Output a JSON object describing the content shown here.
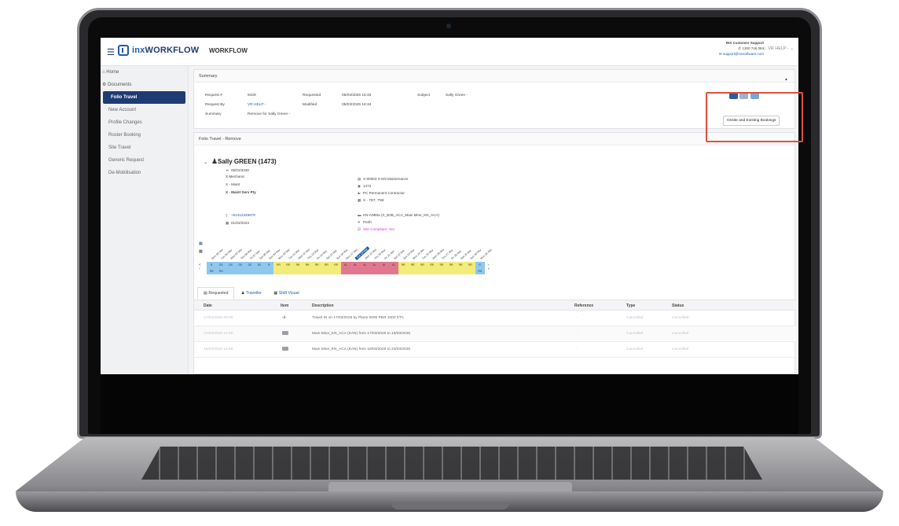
{
  "header": {
    "logo": "WORKFLOW",
    "logo_prefix": "inx",
    "app_title": "WORKFLOW",
    "support_title": "INX Customer Support",
    "support_phone": "1300 746 084",
    "support_email": "support@inxsoftware.com",
    "user": "VR HELP -"
  },
  "sidebar": {
    "items": [
      {
        "label": "Home"
      },
      {
        "label": "Documents"
      },
      {
        "label": "Folio Travel"
      },
      {
        "label": "New Account"
      },
      {
        "label": "Profile Changes"
      },
      {
        "label": "Roster Booking"
      },
      {
        "label": "Site Travel"
      },
      {
        "label": "Generic Request"
      },
      {
        "label": "De-Mobilisation"
      }
    ]
  },
  "summary": {
    "title": "Summary",
    "request_no_label": "Request #",
    "request_no": "9429",
    "request_by_label": "Request By",
    "request_by": "VR HELP -",
    "summary_label": "Summary",
    "summary_value": "Remove for Sally Green -",
    "requested_label": "Requested",
    "requested": "05/03/2025 16:33",
    "modified_label": "Modified",
    "modified": "05/03/2025 16:34",
    "subject_label": "Subject",
    "subject": "Sally Green -",
    "tooltip": "Onsite and Existing Bookings"
  },
  "folio": {
    "title": "Folio Travel - Remove",
    "name": "Sally GREEN (1473)",
    "dob": "05/02/2030",
    "role": "X-Mechanic",
    "dept": "X - Maint",
    "company": "X - Maint Serv Pty",
    "phone": "+61412345678",
    "date": "01/02/2023",
    "cost_centre": "X-00003 X-KN-Maintenance",
    "id": "1473",
    "employment": "PC Permanent Contractor",
    "roster": "X - 7D7, 7N8",
    "accommodation": "KN-A0B0a (X_B2B_ACA_Main Mine_KN_ACA)",
    "city": "Perth",
    "site_compliant": "Site Compliant: Yes"
  },
  "calendar": {
    "days": [
      "Mon 03 Mar",
      "Tue 04 Mar",
      "Wed 05 Mar",
      "Thu 06 Mar",
      "Fri 07 Mar",
      "Sat 08 Mar",
      "Sun 09 Mar",
      "Mon 10 Mar",
      "Tue 11 Mar",
      "Wed 12 Mar",
      "Thu 13 Mar",
      "Fri 14 Mar",
      "Sat 15 Mar",
      "Sun 16 Mar",
      "Mon 17 Mar",
      "Tue 18 Mar",
      "Wed 19 Mar",
      "Thu 20 Mar",
      "Fri 21 Mar",
      "Sat 22 Mar",
      "Sun 23 Mar",
      "Mon 24 Mar",
      "Tue 25 Mar",
      "Wed 26 Mar",
      "Thu 27 Mar",
      "Fri 28 Mar",
      "Sat 29 Mar",
      "Sun 30 Mar",
      "Mon 31 Mar"
    ],
    "codes": [
      "R",
      "DS",
      "DS",
      "DS",
      "DS",
      "DS",
      "R",
      "RR",
      "RR",
      "RR",
      "RR",
      "RR",
      "RR",
      "RR",
      "AL",
      "AL",
      "AL",
      "AL",
      "AL",
      "AL",
      "RR",
      "RR",
      "RR",
      "RR",
      "RR",
      "RR",
      "RR",
      "RR",
      "R"
    ],
    "sub_codes": [
      "RN",
      "RN",
      "",
      "",
      "",
      "",
      "",
      "",
      "",
      "",
      "",
      "",
      "",
      "",
      "",
      "",
      "",
      "",
      "",
      "",
      "",
      "",
      "",
      "",
      "",
      "",
      "",
      "",
      "RN"
    ],
    "today_index": 15,
    "prev": "< ‹",
    "next": "› »"
  },
  "tabs": [
    {
      "label": "Requested"
    },
    {
      "label": "Traveller"
    },
    {
      "label": "Shift Visual"
    }
  ],
  "table": {
    "headers": [
      "Date",
      "Item",
      "Description",
      "Reference",
      "Type",
      "Status"
    ],
    "rows": [
      {
        "date": "17/03/2025 09:00",
        "description": "Travel IN on 17/03/2025 by Plane 0000 PER 1000 KTA",
        "reference": "-",
        "type": "Cancelled",
        "status": "Cancelled"
      },
      {
        "date": "17/03/2025 14:00",
        "description": "Main Mine_KN_ACA (KAN) from 17/03/2025 to 18/03/2025",
        "reference": "-",
        "type": "Cancelled",
        "status": "Cancelled"
      },
      {
        "date": "18/03/2025 14:00",
        "description": "Main Mine_KN_ACA (KAN) from 18/03/2025 to 23/03/2025",
        "reference": "-",
        "type": "Cancelled",
        "status": "Cancelled"
      }
    ]
  },
  "colors": {
    "brand": "#1f3b73",
    "link": "#1f5aa8",
    "rest": "#8ec8ef",
    "roster": "#f3ec7a",
    "leave": "#e07990",
    "highlight": "#e0503e"
  }
}
